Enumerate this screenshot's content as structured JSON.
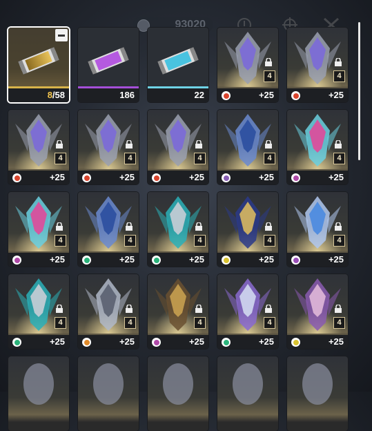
{
  "topbar": {
    "currency_amount": "93020",
    "icons": [
      "info-icon",
      "crosshair-icon",
      "swords-icon"
    ]
  },
  "materials": [
    {
      "name": "gold-capsule",
      "count_current": "8",
      "count_total": "/58",
      "accent": "#e8c25a",
      "line": "#d8b44a",
      "selected": true
    },
    {
      "name": "purple-capsule",
      "count": "186",
      "accent": "#b55ae0",
      "line": "#a54fd8"
    },
    {
      "name": "blue-capsule",
      "count": "22",
      "accent": "#49c3e0",
      "line": "#6fd3e6"
    }
  ],
  "cards": [
    {
      "art": "silver-winged-helm",
      "element_color": "#d9452e",
      "element": "fire-icon",
      "level": "4",
      "bonus": "+25"
    },
    {
      "art": "silver-winged-helm",
      "element_color": "#d9452e",
      "element": "fire-icon",
      "level": "4",
      "bonus": "+25"
    },
    {
      "art": "silver-winged-helm",
      "element_color": "#d9452e",
      "element": "fire-icon",
      "level": "4",
      "bonus": "+25"
    },
    {
      "art": "silver-winged-helm",
      "element_color": "#d9452e",
      "element": "fire-icon",
      "level": "4",
      "bonus": "+25"
    },
    {
      "art": "silver-winged-helm",
      "element_color": "#d9452e",
      "element": "fire-icon",
      "level": "4",
      "bonus": "+25"
    },
    {
      "art": "dark-blue-sword",
      "element_color": "#8a5fb5",
      "element": "scissors-icon",
      "level": "4",
      "bonus": "+25"
    },
    {
      "art": "pink-tentacle-mask",
      "element_color": "#b04aa8",
      "element": "face-icon",
      "level": "4",
      "bonus": "+25"
    },
    {
      "art": "pink-tentacle-mask",
      "element_color": "#b04aa8",
      "element": "face-icon",
      "level": "4",
      "bonus": "+25"
    },
    {
      "art": "dark-blue-sword",
      "element_color": "#2bb37a",
      "element": "leaf-icon",
      "level": "4",
      "bonus": "+25"
    },
    {
      "art": "astronaut-armor",
      "element_color": "#2bb37a",
      "element": "leaf-icon",
      "level": "4",
      "bonus": "+25"
    },
    {
      "art": "gold-visor-helm",
      "element_color": "#d8c230",
      "element": "shield-icon",
      "level": "4",
      "bonus": "+25"
    },
    {
      "art": "blue-serpent-dragon",
      "element_color": "#9a4fb8",
      "element": "battery-icon",
      "level": "4",
      "bonus": "+25"
    },
    {
      "art": "astronaut-armor",
      "element_color": "#2bb37a",
      "element": "leaf-icon",
      "level": "4",
      "bonus": "+25"
    },
    {
      "art": "dark-crowned-knight",
      "element_color": "#e08a2a",
      "element": "ring-icon",
      "level": "4",
      "bonus": "+25"
    },
    {
      "art": "gold-face-mask",
      "element_color": "#b04aa8",
      "element": "face-icon",
      "level": "4",
      "bonus": "+25"
    },
    {
      "art": "horned-dragon-head",
      "element_color": "#2bb37a",
      "element": "arrow-icon",
      "level": "4",
      "bonus": "+25"
    },
    {
      "art": "ram-horned-mask",
      "element_color": "#d8c230",
      "element": "star-icon",
      "level": "4",
      "bonus": "+25"
    }
  ],
  "partial_row": [
    "white-hooded-figure",
    "witch-hat-figure",
    "furry-beast",
    "red-visor-robot",
    "cyan-crystal"
  ]
}
